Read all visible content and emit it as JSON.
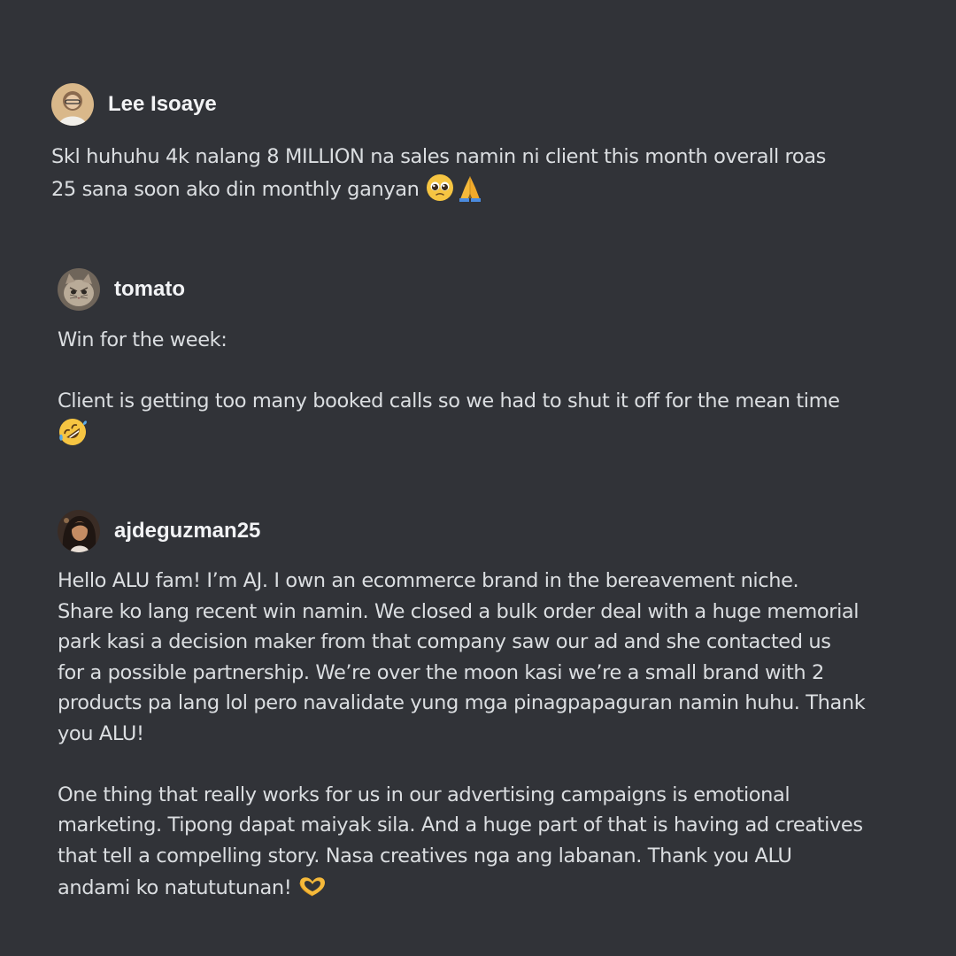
{
  "colors": {
    "background": "#313338",
    "text": "#dbdee1",
    "username": "#f2f3f5"
  },
  "messages": [
    {
      "username": "Lee Isoaye",
      "avatar_icon": "user-avatar-icon",
      "lines": [
        "Skl huhuhu 4k nalang 8 MILLION na sales namin ni client this month overall roas",
        "25 sana soon ako din monthly ganyan "
      ],
      "emojis": [
        "pleading-face-icon",
        "folded-hands-icon"
      ]
    },
    {
      "username": "tomato",
      "avatar_icon": "cat-avatar-icon",
      "paragraphs": [
        "Win for the week:",
        "Client is getting too many booked calls so we had to shut it off for the mean time"
      ],
      "emojis": [
        "rolling-on-floor-laughing-icon"
      ]
    },
    {
      "username": "ajdeguzman25",
      "avatar_icon": "user-avatar-icon",
      "paragraph1_lines": [
        "Hello ALU fam! I’m AJ. I own an ecommerce brand in the bereavement niche.",
        "Share ko lang recent win namin. We closed a bulk order deal with a huge memorial",
        "park kasi a decision maker from that company saw our ad and she contacted us",
        "for a possible partnership. We’re over the moon kasi we’re a small brand with 2",
        "products pa lang lol pero navalidate yung mga pinagpapaguran namin huhu. Thank",
        "you ALU!"
      ],
      "paragraph2_lines": [
        "One thing that really works for us in our advertising campaigns is emotional",
        "marketing. Tipong dapat maiyak sila. And a huge part of that is having ad creatives",
        "that tell a compelling story. Nasa creatives nga ang labanan. Thank you ALU",
        "andami ko natututunan! "
      ],
      "emojis": [
        "heart-hands-icon"
      ]
    }
  ]
}
